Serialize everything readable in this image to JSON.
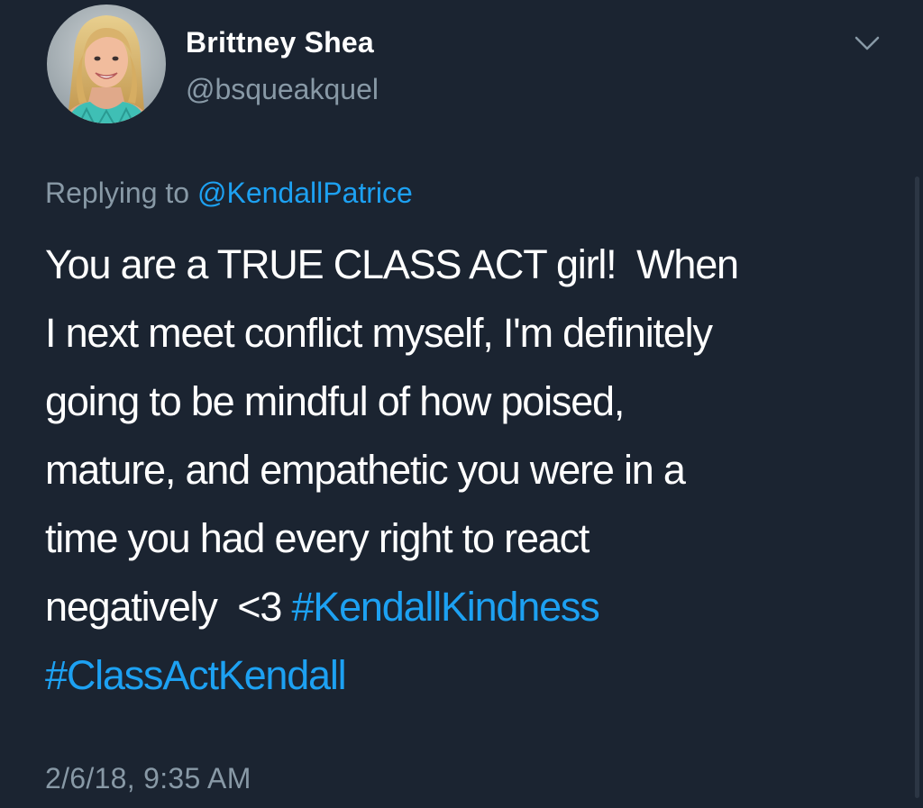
{
  "author": {
    "display_name": "Brittney Shea",
    "handle": "@bsqueakquel"
  },
  "reply": {
    "prefix": "Replying to ",
    "mention": "@KendallPatrice"
  },
  "tweet": {
    "lines": [
      "You are a TRUE CLASS ACT girl!  When",
      "I next meet conflict myself, I'm definitely",
      "going to be mindful of how poised,",
      "mature, and empathetic you were in a",
      "time you had every right to react",
      "negatively  <3 "
    ],
    "hashtags": [
      "#KendallKindness",
      "#ClassActKendall"
    ]
  },
  "timestamp": "2/6/18, 9:35 AM",
  "icons": {
    "menu": "chevron-down-icon",
    "avatar": "profile-photo"
  },
  "colors": {
    "background": "#1b2431",
    "link": "#1da1f2",
    "secondary_text": "#8899a6",
    "primary_text": "#ffffff"
  }
}
